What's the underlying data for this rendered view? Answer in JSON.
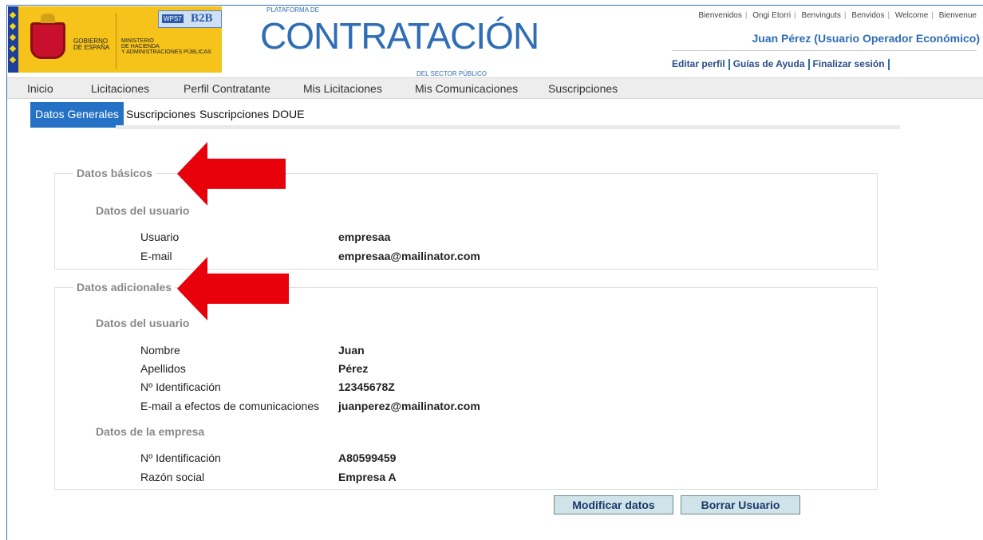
{
  "header": {
    "gov_line1": "Gobierno",
    "gov_line2": "de España",
    "min_line1": "Ministerio",
    "min_line2": "de Hacienda",
    "min_line3": "y Administraciones Públicas",
    "badge_small": "WPS7",
    "badge_big": "B2B",
    "logo_top": "PLATAFORMA DE",
    "logo_main": "CONTRATACIÓN",
    "logo_sub": "DEL SECTOR PÚBLICO",
    "languages": [
      "Bienvenidos",
      "Ongi Etorri",
      "Benvinguts",
      "Benvidos",
      "Welcome",
      "Bienvenue"
    ],
    "user_display": "Juan Pérez (Usuario Operador Económico)",
    "links": [
      "Editar perfil",
      "Guías de Ayuda",
      "Finalizar sesión"
    ]
  },
  "mainnav": [
    "Inicio",
    "Licitaciones",
    "Perfil Contratante",
    "Mis Licitaciones",
    "Mis Comunicaciones",
    "Suscripciones"
  ],
  "subnav": {
    "active": "Datos Generales",
    "tabs": [
      "Datos Generales",
      "Suscripciones",
      "Suscripciones DOUE"
    ]
  },
  "basicos": {
    "legend": "Datos básicos",
    "section": "Datos del usuario",
    "rows": [
      {
        "label": "Usuario",
        "value": "empresaa"
      },
      {
        "label": "E-mail",
        "value": "empresaa@mailinator.com"
      }
    ]
  },
  "adicionales": {
    "legend": "Datos adicionales",
    "section_user": "Datos del usuario",
    "user_rows": [
      {
        "label": "Nombre",
        "value": "Juan"
      },
      {
        "label": "Apellidos",
        "value": "Pérez"
      },
      {
        "label": "Nº Identificación",
        "value": "12345678Z"
      },
      {
        "label": "E-mail a efectos de comunicaciones",
        "value": "juanperez@mailinator.com"
      }
    ],
    "section_company": "Datos de la empresa",
    "company_rows": [
      {
        "label": "Nº Identificación",
        "value": "A80599459"
      },
      {
        "label": "Razón social",
        "value": "Empresa A"
      }
    ]
  },
  "buttons": {
    "modify": "Modificar datos",
    "delete": "Borrar Usuario"
  },
  "colors": {
    "brand_blue": "#2f6db5",
    "active_tab": "#2471c5",
    "annotation_arrow": "#e8000b",
    "gov_yellow": "#f5c31a"
  }
}
